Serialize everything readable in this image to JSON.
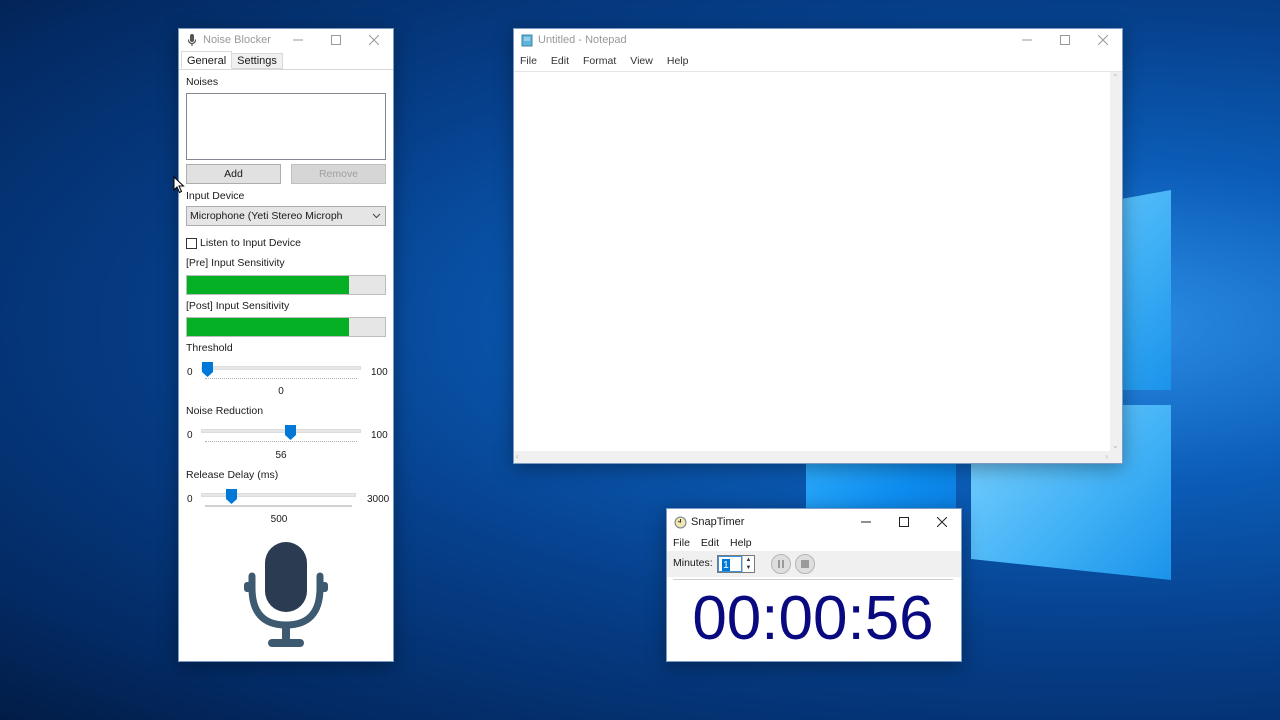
{
  "desktop": {
    "accent": "#0b5db8"
  },
  "noise_blocker": {
    "title": "Noise Blocker",
    "tabs": [
      {
        "label": "General",
        "active": true
      },
      {
        "label": "Settings",
        "active": false
      }
    ],
    "noises_label": "Noises",
    "noises_items": [],
    "add_label": "Add",
    "remove_label": "Remove",
    "input_device_label": "Input Device",
    "input_device_value": "Microphone (Yeti Stereo Microph",
    "listen_label": "Listen to Input Device",
    "listen_checked": false,
    "pre_sensitivity_label": "[Pre] Input Sensitivity",
    "pre_sensitivity_percent": 82,
    "post_sensitivity_label": "[Post] Input Sensitivity",
    "post_sensitivity_percent": 82,
    "progress_color": "#06b025",
    "threshold": {
      "label": "Threshold",
      "min": "0",
      "max": "100",
      "value": 0
    },
    "noise_reduction": {
      "label": "Noise Reduction",
      "min": "0",
      "max": "100",
      "value": 56
    },
    "release_delay": {
      "label": "Release Delay (ms)",
      "min": "0",
      "max": "3000",
      "value": 500
    },
    "slider_thumb_color": "#0078d7",
    "mic_icon": "microphone-icon"
  },
  "notepad": {
    "title": "Untitled - Notepad",
    "menu": [
      "File",
      "Edit",
      "Format",
      "View",
      "Help"
    ],
    "content": ""
  },
  "snaptimer": {
    "title": "SnapTimer",
    "menu": [
      "File",
      "Edit",
      "Help"
    ],
    "minutes_label": "Minutes:",
    "minutes_value": "1",
    "time_display": "00:00:56",
    "display_color": "#0a0a80"
  }
}
